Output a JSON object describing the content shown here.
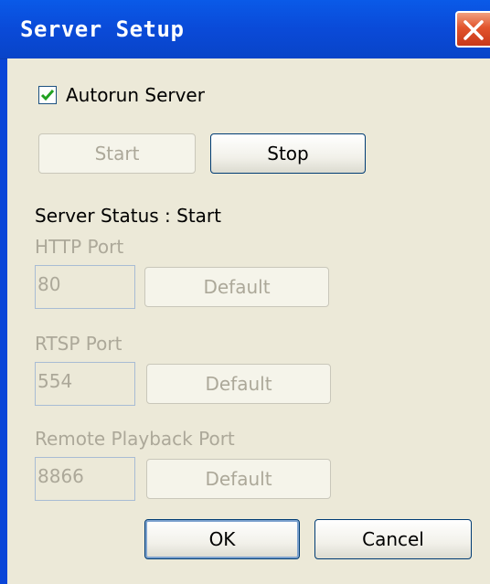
{
  "window": {
    "title": "Server Setup"
  },
  "autorun": {
    "label": "Autorun Server",
    "checked": true
  },
  "server_buttons": {
    "start_label": "Start",
    "stop_label": "Stop"
  },
  "status": {
    "text": "Server Status : Start"
  },
  "http": {
    "label": "HTTP Port",
    "value": "80",
    "default_label": "Default"
  },
  "rtsp": {
    "label": "RTSP Port",
    "value": "554",
    "default_label": "Default"
  },
  "playback": {
    "label": "Remote Playback Port",
    "value": "8866",
    "default_label": "Default"
  },
  "footer": {
    "ok_label": "OK",
    "cancel_label": "Cancel"
  },
  "colors": {
    "titlebar": "#0A4AD8",
    "dialog_bg": "#ECE9D8",
    "disabled_text": "#ACA899",
    "close": "#E2542C"
  }
}
